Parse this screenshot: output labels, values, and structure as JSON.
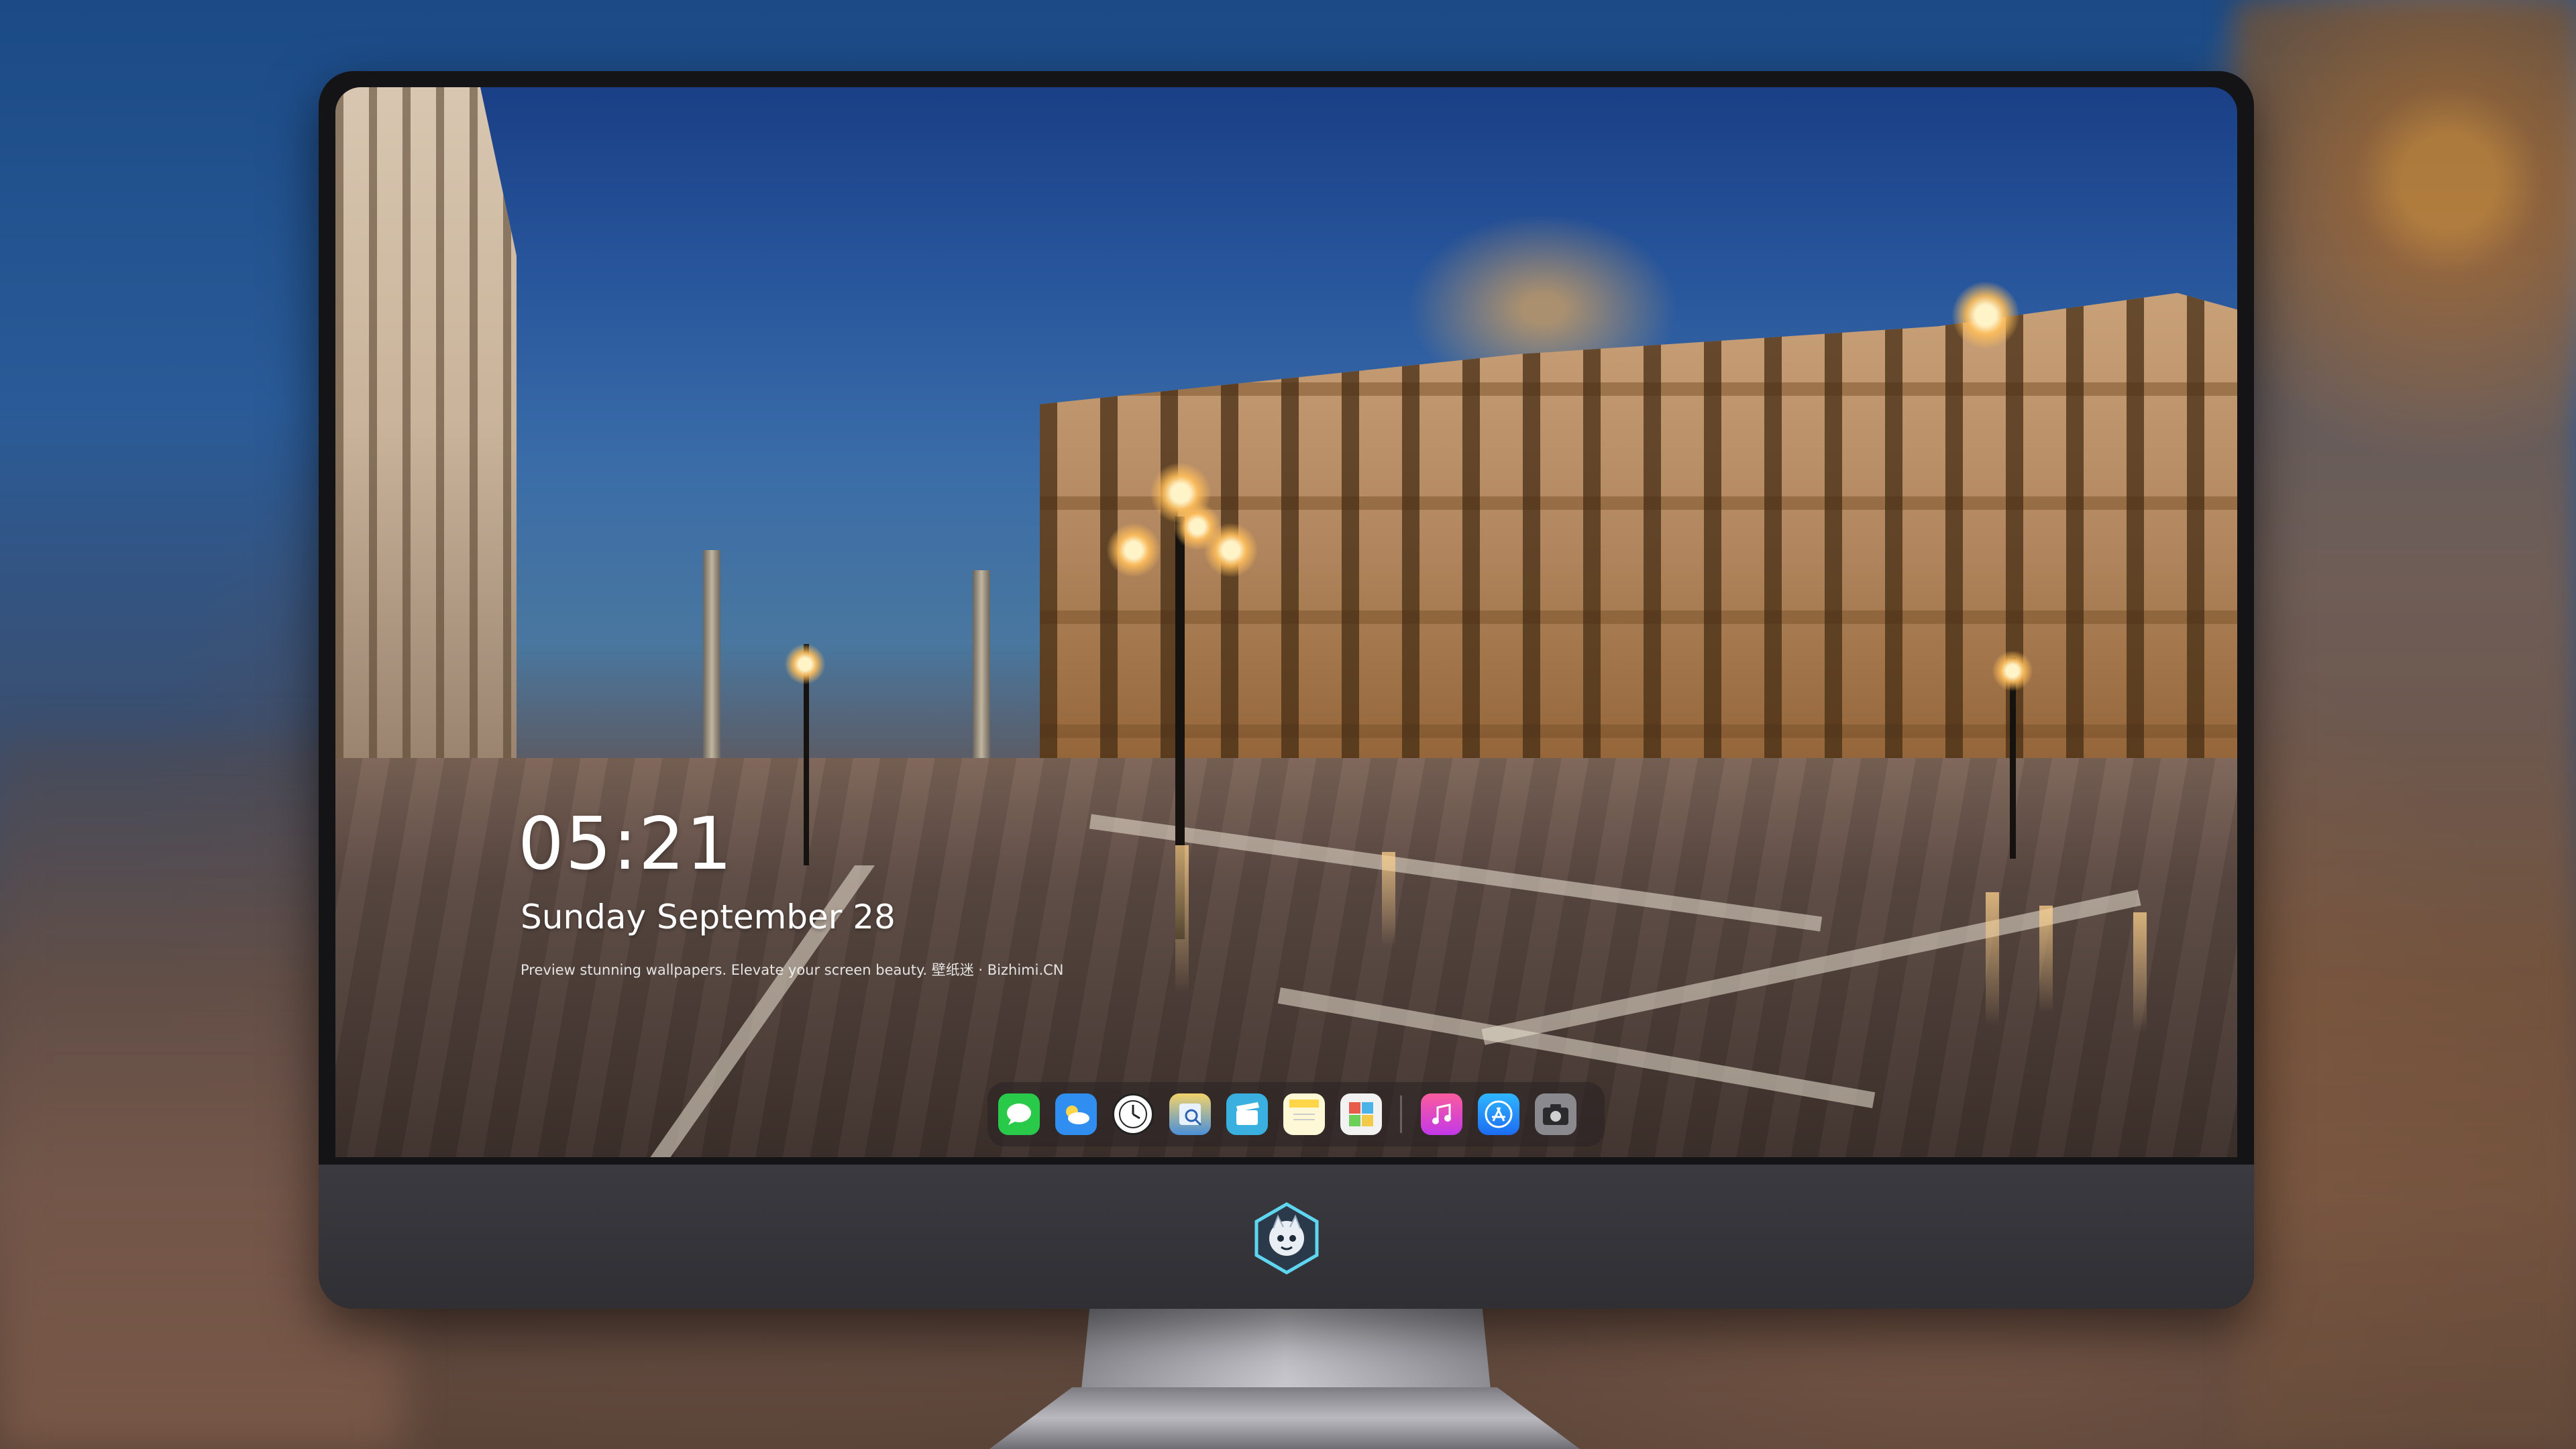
{
  "lockscreen": {
    "time": "05:21",
    "date": "Sunday September  28",
    "tagline": "Preview stunning wallpapers. Elevate your screen beauty. 壁纸迷 · Bizhimi.CN"
  },
  "dock": {
    "apps": [
      {
        "name": "messages-icon",
        "color": "#29c94a"
      },
      {
        "name": "weather-icon",
        "color": "#2f8ef0"
      },
      {
        "name": "clock-icon",
        "color": "#ffffff"
      },
      {
        "name": "preview-icon",
        "color": "#4a90d9"
      },
      {
        "name": "clips-icon",
        "color": "#39b0e0"
      },
      {
        "name": "notes-icon",
        "color": "#ffd54a"
      },
      {
        "name": "photo-booth-icon",
        "color": "#e85b4a"
      },
      {
        "name": "music-icon",
        "color": "#fb4c84"
      },
      {
        "name": "app-store-icon",
        "color": "#1c7cf2"
      },
      {
        "name": "screenshot-icon",
        "color": "#8a8a8e"
      }
    ]
  }
}
